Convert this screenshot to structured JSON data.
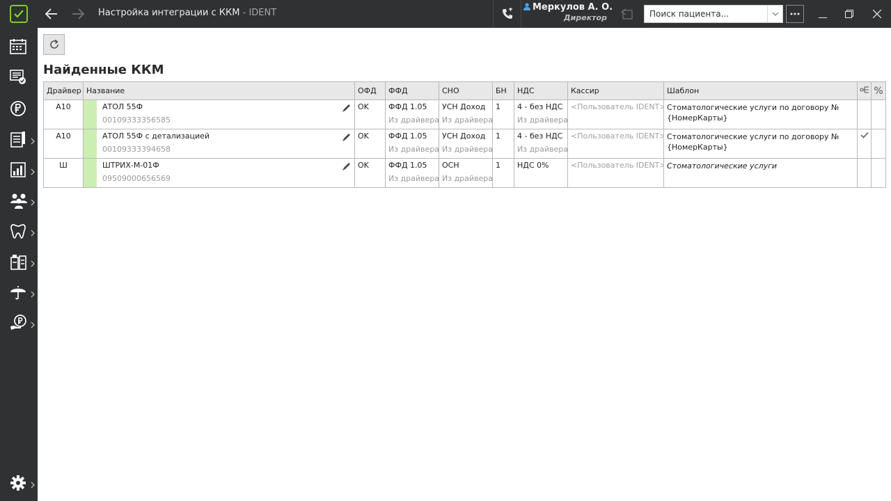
{
  "window": {
    "title": "Настройка интеграции с ККМ",
    "title_sep": " - ",
    "app_name": "IDENT"
  },
  "user": {
    "name": "Меркулов А. О.",
    "role": "Директор"
  },
  "search": {
    "placeholder": "Поиск пациента..."
  },
  "icons": {
    "logo": "check-square-logo",
    "back": "arrow-left-icon",
    "forward": "arrow-right-icon",
    "call": "phone-icon",
    "user": "user-icon",
    "history": "history-back-icon",
    "more": "ellipsis-icon",
    "minimize": "minimize-icon",
    "maximize": "restore-icon",
    "close": "close-icon",
    "refresh": "refresh-icon",
    "edit": "pencil-icon",
    "tree": "tree-settings-icon",
    "percent": "percent-icon",
    "check": "checkmark-icon"
  },
  "sidebar": {
    "items": [
      {
        "name": "schedule-icon"
      },
      {
        "name": "visits-icon"
      },
      {
        "name": "ruble-icon"
      },
      {
        "name": "reports-icon"
      },
      {
        "name": "analytics-icon"
      },
      {
        "name": "staff-icon"
      },
      {
        "name": "tooth-icon"
      },
      {
        "name": "lab-icon"
      },
      {
        "name": "insurance-umbrella-icon"
      },
      {
        "name": "payment-hand-icon"
      },
      {
        "name": "settings-gear-icon"
      }
    ]
  },
  "main": {
    "title": "Найденные ККМ"
  },
  "table": {
    "headers": {
      "driver": "Драйвер",
      "name": "Название",
      "ofd": "ОФД",
      "ffd": "ФФД",
      "sno": "СНО",
      "bn": "БН",
      "nds": "НДС",
      "cashier": "Кассир",
      "template": "Шаблон",
      "percent": "%"
    },
    "rows": [
      {
        "driver": "А10",
        "name": "АТОЛ 55Ф",
        "serial": "00109333356585",
        "ofd": "OK",
        "ffd": "ФФД 1.05",
        "ffd_sub": "Из драйвера",
        "sno": "УСН Доход",
        "sno_sub": "Из драйвера",
        "bn": "1",
        "nds": "4 - без НДС",
        "nds_sub": "Из драйвера",
        "cashier": "<Пользователь IDENT>",
        "template": "Стоматологические услуги по договору №{НомерКарты}",
        "checked": false
      },
      {
        "driver": "А10",
        "name": "АТОЛ 55Ф с детализацией",
        "serial": "00109333394658",
        "ofd": "OK",
        "ffd": "ФФД 1.05",
        "ffd_sub": "Из драйвера",
        "sno": "УСН Доход",
        "sno_sub": "Из драйвера",
        "bn": "1",
        "nds": "4 - без НДС",
        "nds_sub": "Из драйвера",
        "cashier": "<Пользователь IDENT>",
        "template": "Стоматологические услуги по договору №{НомерКарты}",
        "checked": true
      },
      {
        "driver": "Ш",
        "name": "ШТРИХ-М-01Ф",
        "serial": "09509000656569",
        "ofd": "OK",
        "ffd": "ФФД 1.05",
        "ffd_sub": "Из драйвера",
        "sno": "ОСН",
        "sno_sub": "Из драйвера",
        "bn": "1",
        "nds": "НДС 0%",
        "nds_sub": "",
        "cashier": "<Пользователь IDENT>",
        "template": "Стоматологические услуги",
        "checked": false
      }
    ]
  },
  "colors": {
    "titlebar": "#2f3133",
    "accent": "#7cd11e",
    "row_strip": "#cdeeb3"
  }
}
